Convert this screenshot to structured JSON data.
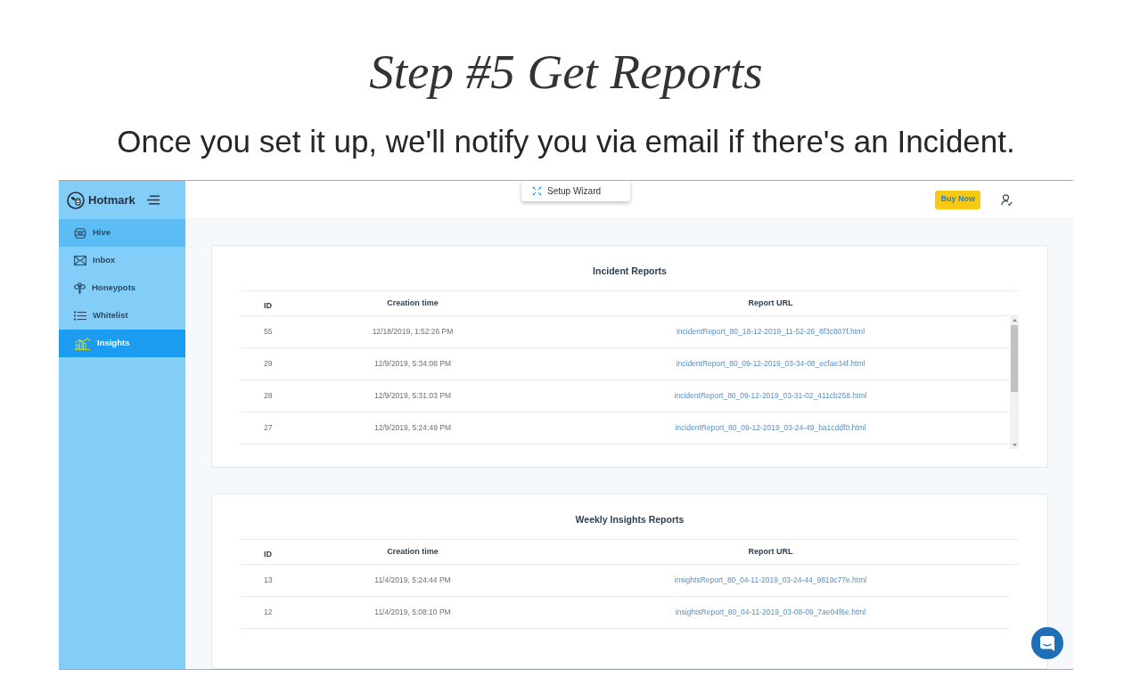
{
  "heading": {
    "title": "Step #5 Get Reports",
    "subtitle": "Once you set it up, we'll notify you via email if there's an Incident."
  },
  "sidebar": {
    "brand": "Hotmark",
    "items": [
      {
        "label": "Hive",
        "selected": false,
        "hovered": true
      },
      {
        "label": "Inbox",
        "selected": false,
        "hovered": false
      },
      {
        "label": "Honeypots",
        "selected": false,
        "hovered": false
      },
      {
        "label": "Whitelist",
        "selected": false,
        "hovered": false
      },
      {
        "label": "Insights",
        "selected": true,
        "hovered": false
      }
    ]
  },
  "topbar": {
    "wizard_tab": "Setup Wizard",
    "buy_button": "Buy Now"
  },
  "panels": [
    {
      "title": "Incident Reports",
      "columns": [
        "ID",
        "Creation time",
        "Report URL"
      ],
      "scrollbar": true,
      "rows": [
        {
          "id": "55",
          "created": "12/18/2019, 1:52:26 PM",
          "url": "incidentReport_80_18-12-2019_11-52-26_8f3c807f.html"
        },
        {
          "id": "29",
          "created": "12/9/2019, 5:34:08 PM",
          "url": "incidentReport_80_09-12-2019_03-34-08_ecfae34f.html"
        },
        {
          "id": "28",
          "created": "12/9/2019, 5:31:03 PM",
          "url": "incidentReport_80_09-12-2019_03-31-02_411cb258.html"
        },
        {
          "id": "27",
          "created": "12/9/2019, 5:24:49 PM",
          "url": "incidentReport_80_09-12-2019_03-24-49_ba1cddf0.html"
        }
      ]
    },
    {
      "title": "Weekly Insights Reports",
      "columns": [
        "ID",
        "Creation time",
        "Report URL"
      ],
      "scrollbar": false,
      "rows": [
        {
          "id": "13",
          "created": "11/4/2019, 5:24:44 PM",
          "url": "insightsReport_80_04-11-2019_03-24-44_9819c77e.html"
        },
        {
          "id": "12",
          "created": "11/4/2019, 5:08:10 PM",
          "url": "insightsReport_80_04-11-2019_03-08-09_7ae04f6e.html"
        }
      ]
    }
  ]
}
